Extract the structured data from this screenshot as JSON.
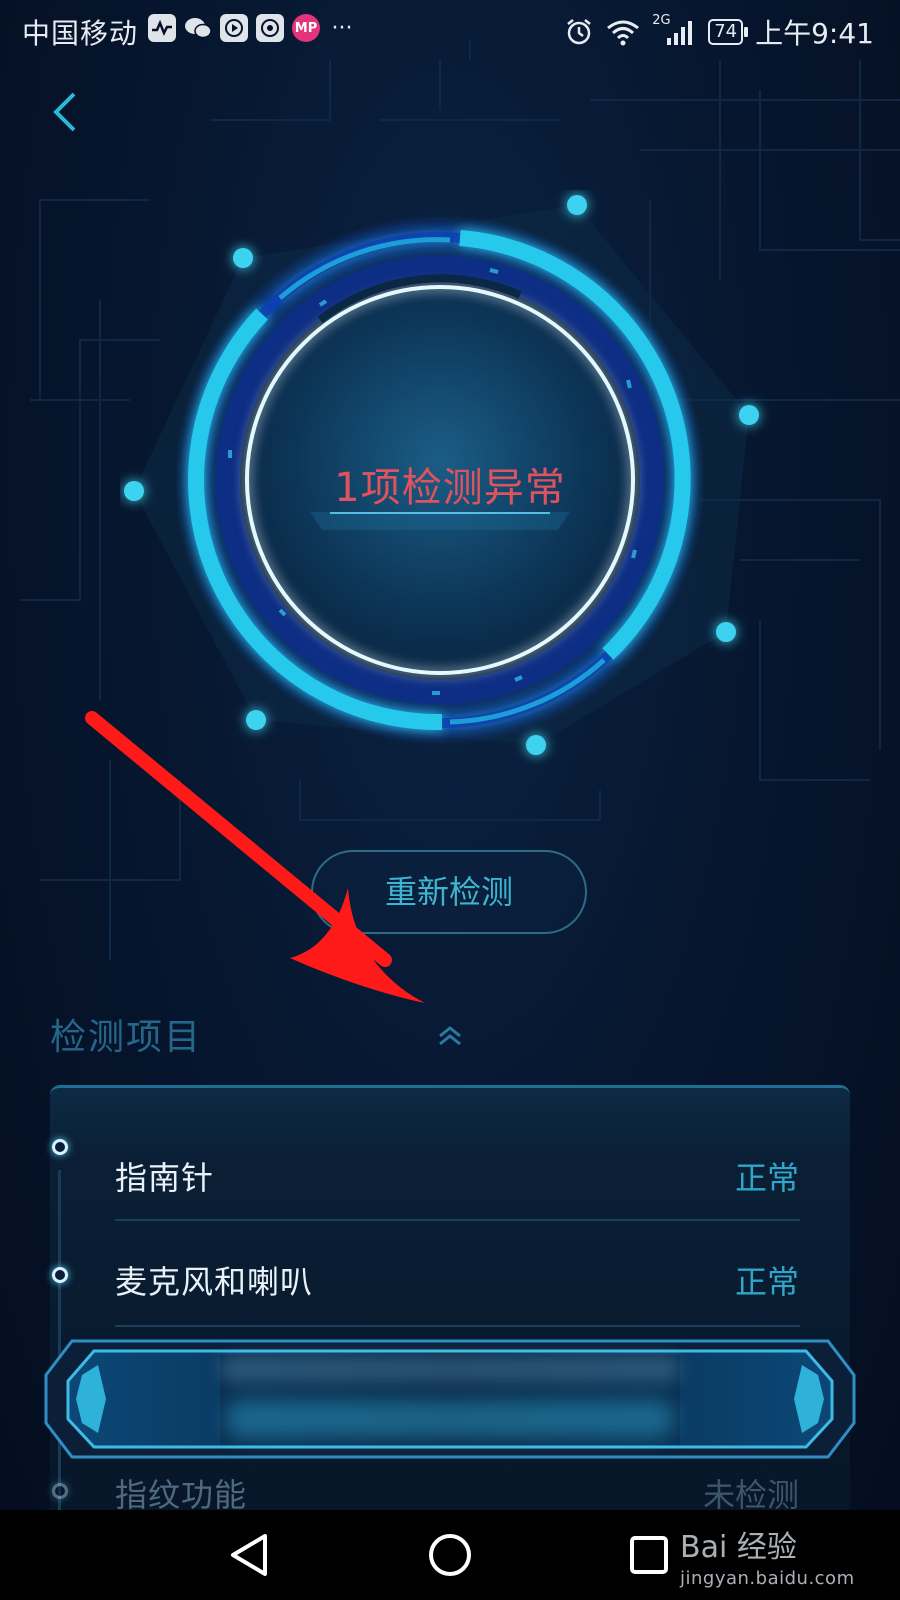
{
  "status_bar": {
    "carrier": "中国移动",
    "mp_badge": "MP",
    "more": "···",
    "network": "2G",
    "battery": "74",
    "time": "上午9:41"
  },
  "gauge": {
    "status_text": "1项检测异常"
  },
  "rescan_button": "重新检测",
  "section": {
    "title": "检测项目"
  },
  "items": [
    {
      "name": "指南针",
      "status": "正常"
    },
    {
      "name": "麦克风和喇叭",
      "status": "正常"
    },
    {
      "name": "指纹功能",
      "status": "未检测"
    }
  ],
  "watermark": {
    "brand": "Bai 经验",
    "url": "jingyan.baidu.com"
  },
  "colors": {
    "accent": "#2bb7d7",
    "alert": "#e1525f",
    "annotation_arrow": "#ff1a1a"
  }
}
